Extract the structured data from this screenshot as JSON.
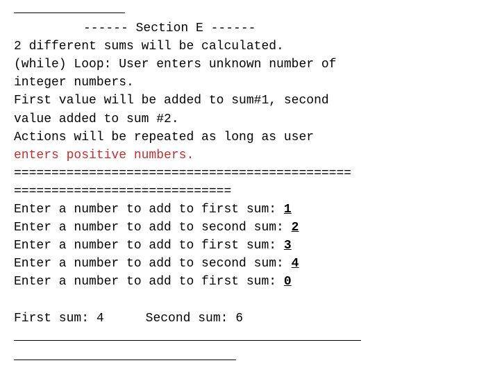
{
  "header_blank": "",
  "section_title": "------ Section E ------",
  "line1": "2 different sums will be calculated.",
  "line2": "(while) Loop: User enters unknown number of",
  "line3": "integer numbers.",
  "line4": "First value will be added to sum#1, second",
  "line5": "value added to sum #2.",
  "line6": "Actions will be repeated as long as user",
  "line7": "enters positive numbers.",
  "sep1": "=============================================",
  "sep2": "=============================",
  "prompts": [
    {
      "text": "Enter a number to add to first sum: ",
      "value": "1"
    },
    {
      "text": "Enter a number to add to second sum: ",
      "value": "2"
    },
    {
      "text": "Enter a number to add to first sum: ",
      "value": "3"
    },
    {
      "text": "Enter a number to add to second sum: ",
      "value": "4"
    },
    {
      "text": "Enter a number to add to first sum: ",
      "value": "0"
    }
  ],
  "first_sum_label": "First sum: ",
  "first_sum_value": "4",
  "second_sum_label": "Second sum: ",
  "second_sum_value": "6"
}
